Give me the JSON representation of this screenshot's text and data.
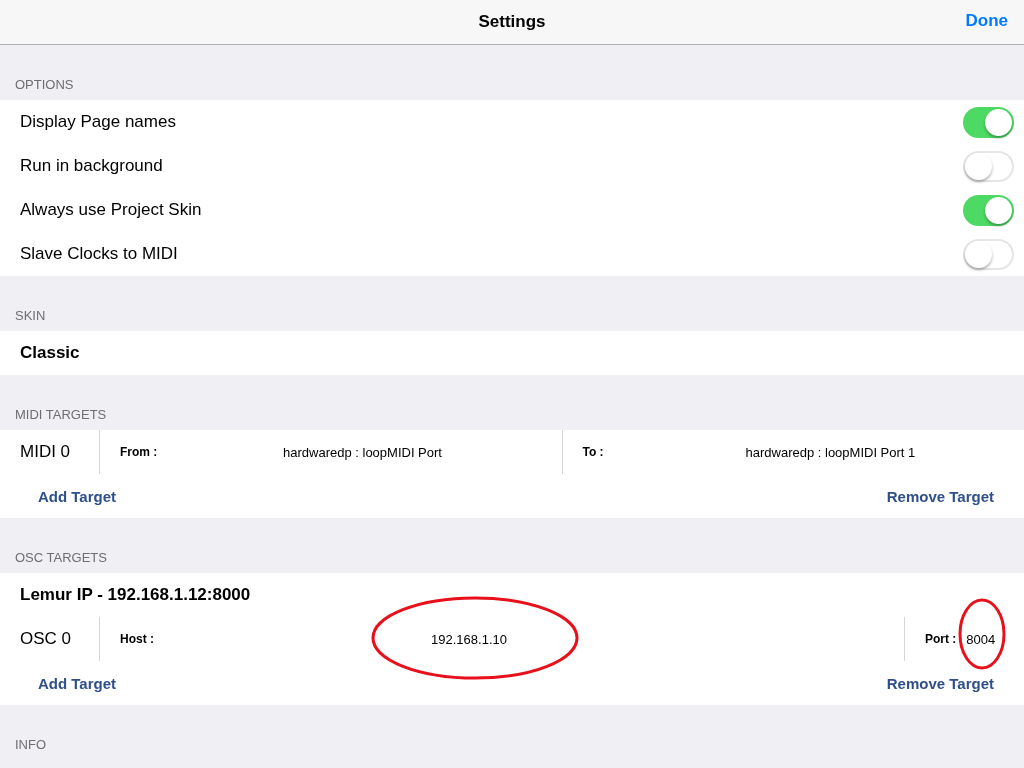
{
  "nav_bar": {
    "title": "Settings",
    "done_button": "Done"
  },
  "options": {
    "header": "OPTIONS",
    "items": [
      {
        "label": "Display Page names",
        "on": true
      },
      {
        "label": "Run in background",
        "on": false
      },
      {
        "label": "Always use Project Skin",
        "on": true
      },
      {
        "label": "Slave Clocks to MIDI",
        "on": false
      }
    ]
  },
  "skin": {
    "header": "SKIN",
    "value": "Classic"
  },
  "midi_targets": {
    "header": "MIDI TARGETS",
    "targets": [
      {
        "name": "MIDI 0",
        "from_label": "From :",
        "from": "hardwaredp : loopMIDI Port",
        "to_label": "To :",
        "to": "hardwaredp : loopMIDI Port 1"
      }
    ],
    "add_button": "Add Target",
    "remove_button": "Remove Target"
  },
  "osc_targets": {
    "header": "OSC TARGETS",
    "lemur_ip": "Lemur IP - 192.168.1.12:8000",
    "targets": [
      {
        "name": "OSC 0",
        "host_label": "Host :",
        "host": "192.168.1.10",
        "port_label": "Port :",
        "port": "8004"
      }
    ],
    "add_button": "Add Target",
    "remove_button": "Remove Target"
  },
  "info": {
    "header": "INFO"
  }
}
